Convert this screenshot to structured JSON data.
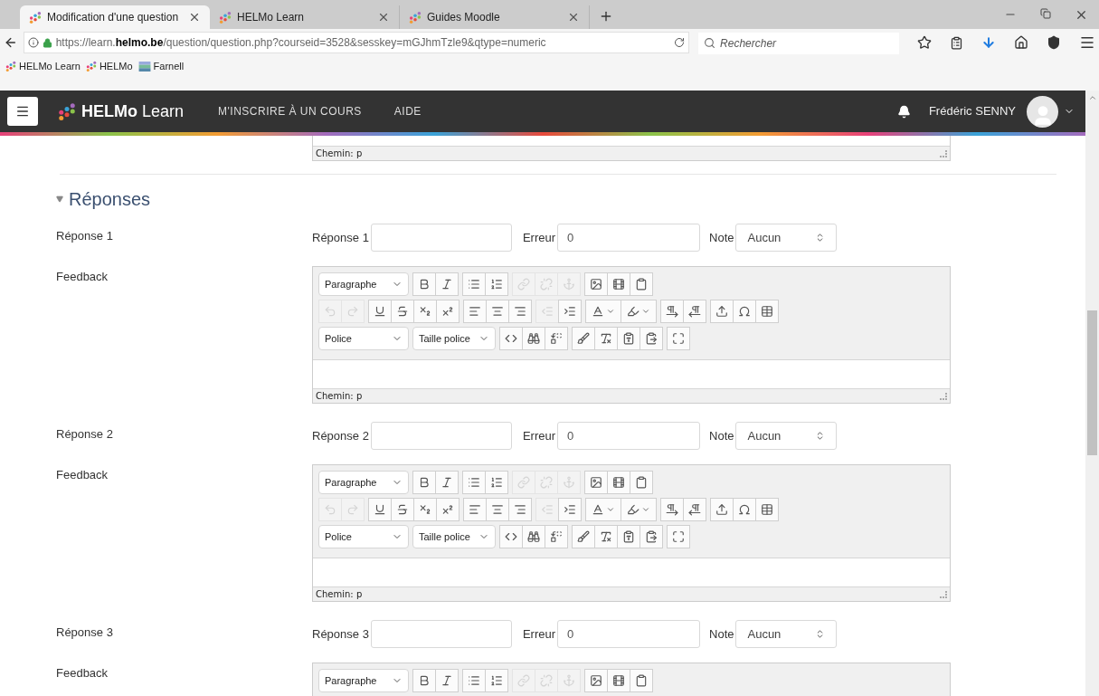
{
  "browser": {
    "tabs": [
      {
        "title": "Modification d'une question",
        "selected": true
      },
      {
        "title": "HELMo Learn",
        "selected": false
      },
      {
        "title": "Guides Moodle",
        "selected": false
      }
    ],
    "url": "https://learn.**helmo.be**/question/question.php?courseid=3528&sesskey=mGJhmTzle9&qtype=numeric",
    "search": {
      "placeholder": "Rechercher"
    },
    "bookmarks": [
      "HELMo Learn",
      "HELMo",
      "Farnell"
    ]
  },
  "navbar": {
    "brand": "**HELMo** Learn",
    "links": [
      "M'INSCRIRE À UN COURS",
      "AIDE"
    ],
    "user": "Frédéric SENNY"
  },
  "previous_editor": {
    "status": "Chemin: p"
  },
  "section": {
    "title": "Réponses",
    "expanded": true,
    "answers": [
      {
        "label": "Réponse 1",
        "answer_label": "Réponse 1",
        "error_label": "Erreur",
        "error_value": "0",
        "grade_label": "Note",
        "grade_value": "Aucun",
        "feedback_label": "Feedback",
        "editor": {
          "toolbar_rows": [
            {
              "dropdowns": [
                "Paragraphe"
              ],
              "buttons": [
                {
                  "disabled": false
                },
                {
                  "disabled": false
                },
                {
                  "disabled": false
                },
                {
                  "disabled": false
                },
                {
                  "disabled": true
                },
                {
                  "disabled": true
                },
                {
                  "disabled": true
                },
                {
                  "disabled": false
                },
                {
                  "disabled": false
                },
                {
                  "disabled": false
                }
              ]
            },
            {
              "buttons": [
                {
                  "disabled": true
                },
                {
                  "disabled": true
                },
                {
                  "disabled": false
                },
                {
                  "disabled": false
                },
                {
                  "disabled": false
                },
                {
                  "disabled": false
                },
                {
                  "disabled": false
                },
                {
                  "disabled": false
                },
                {
                  "disabled": false
                },
                {
                  "disabled": true
                },
                {
                  "disabled": false
                },
                {
                  "disabled": false
                },
                {
                  "disabled": false
                },
                {
                  "disabled": false
                },
                {
                  "disabled": false
                },
                {
                  "disabled": false
                },
                {
                  "disabled": false
                },
                {
                  "disabled": false
                }
              ]
            },
            {
              "dropdowns": [
                "Police",
                "Taille police"
              ],
              "buttons": [
                {
                  "disabled": false
                },
                {
                  "disabled": false
                },
                {
                  "disabled": false
                },
                {
                  "disabled": false
                },
                {
                  "disabled": false
                },
                {
                  "disabled": false
                },
                {
                  "disabled": false
                },
                {
                  "disabled": false
                }
              ]
            }
          ],
          "status": "Chemin: p"
        }
      },
      {
        "label": "Réponse 2",
        "answer_label": "Réponse 2",
        "error_label": "Erreur",
        "error_value": "0",
        "grade_label": "Note",
        "grade_value": "Aucun",
        "feedback_label": "Feedback",
        "editor": {
          "toolbar_rows": [
            {
              "dropdowns": [
                "Paragraphe"
              ],
              "buttons": [
                {
                  "disabled": false
                },
                {
                  "disabled": false
                },
                {
                  "disabled": false
                },
                {
                  "disabled": false
                },
                {
                  "disabled": true
                },
                {
                  "disabled": true
                },
                {
                  "disabled": true
                },
                {
                  "disabled": false
                },
                {
                  "disabled": false
                },
                {
                  "disabled": false
                }
              ]
            },
            {
              "buttons": [
                {
                  "disabled": true
                },
                {
                  "disabled": true
                },
                {
                  "disabled": false
                },
                {
                  "disabled": false
                },
                {
                  "disabled": false
                },
                {
                  "disabled": false
                },
                {
                  "disabled": false
                },
                {
                  "disabled": false
                },
                {
                  "disabled": false
                },
                {
                  "disabled": true
                },
                {
                  "disabled": false
                },
                {
                  "disabled": false
                },
                {
                  "disabled": false
                },
                {
                  "disabled": false
                },
                {
                  "disabled": false
                },
                {
                  "disabled": false
                },
                {
                  "disabled": false
                },
                {
                  "disabled": false
                }
              ]
            },
            {
              "dropdowns": [
                "Police",
                "Taille police"
              ],
              "buttons": [
                {
                  "disabled": false
                },
                {
                  "disabled": false
                },
                {
                  "disabled": false
                },
                {
                  "disabled": false
                },
                {
                  "disabled": false
                },
                {
                  "disabled": false
                },
                {
                  "disabled": false
                },
                {
                  "disabled": false
                }
              ]
            }
          ],
          "status": "Chemin: p"
        }
      },
      {
        "label": "Réponse 3",
        "answer_label": "Réponse 3",
        "error_label": "Erreur",
        "error_value": "0",
        "grade_label": "Note",
        "grade_value": "Aucun",
        "feedback_label": "Feedback",
        "editor": {
          "toolbar_rows": [
            {
              "dropdowns": [
                "Paragraphe"
              ],
              "buttons": [
                {
                  "disabled": false
                },
                {
                  "disabled": false
                },
                {
                  "disabled": false
                },
                {
                  "disabled": false
                },
                {
                  "disabled": true
                },
                {
                  "disabled": true
                },
                {
                  "disabled": true
                },
                {
                  "disabled": false
                },
                {
                  "disabled": false
                },
                {
                  "disabled": false
                }
              ]
            }
          ]
        }
      }
    ]
  }
}
